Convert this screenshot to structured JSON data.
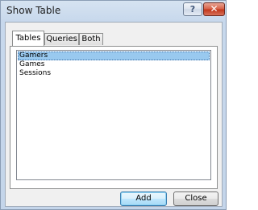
{
  "window": {
    "title": "Show Table",
    "help_label": "?",
    "close_label": "✕"
  },
  "tabs": [
    {
      "label": "Tables",
      "active": true
    },
    {
      "label": "Queries",
      "active": false
    },
    {
      "label": "Both",
      "active": false
    }
  ],
  "list": {
    "items": [
      {
        "label": "Gamers",
        "selected": true
      },
      {
        "label": "Games",
        "selected": false
      },
      {
        "label": "Sessions",
        "selected": false
      }
    ]
  },
  "buttons": {
    "add_label": "Add",
    "close_label": "Close"
  },
  "colors": {
    "selection": "#99c9ef",
    "close_button": "#c2381c",
    "default_button_border": "#3c7fb1"
  }
}
